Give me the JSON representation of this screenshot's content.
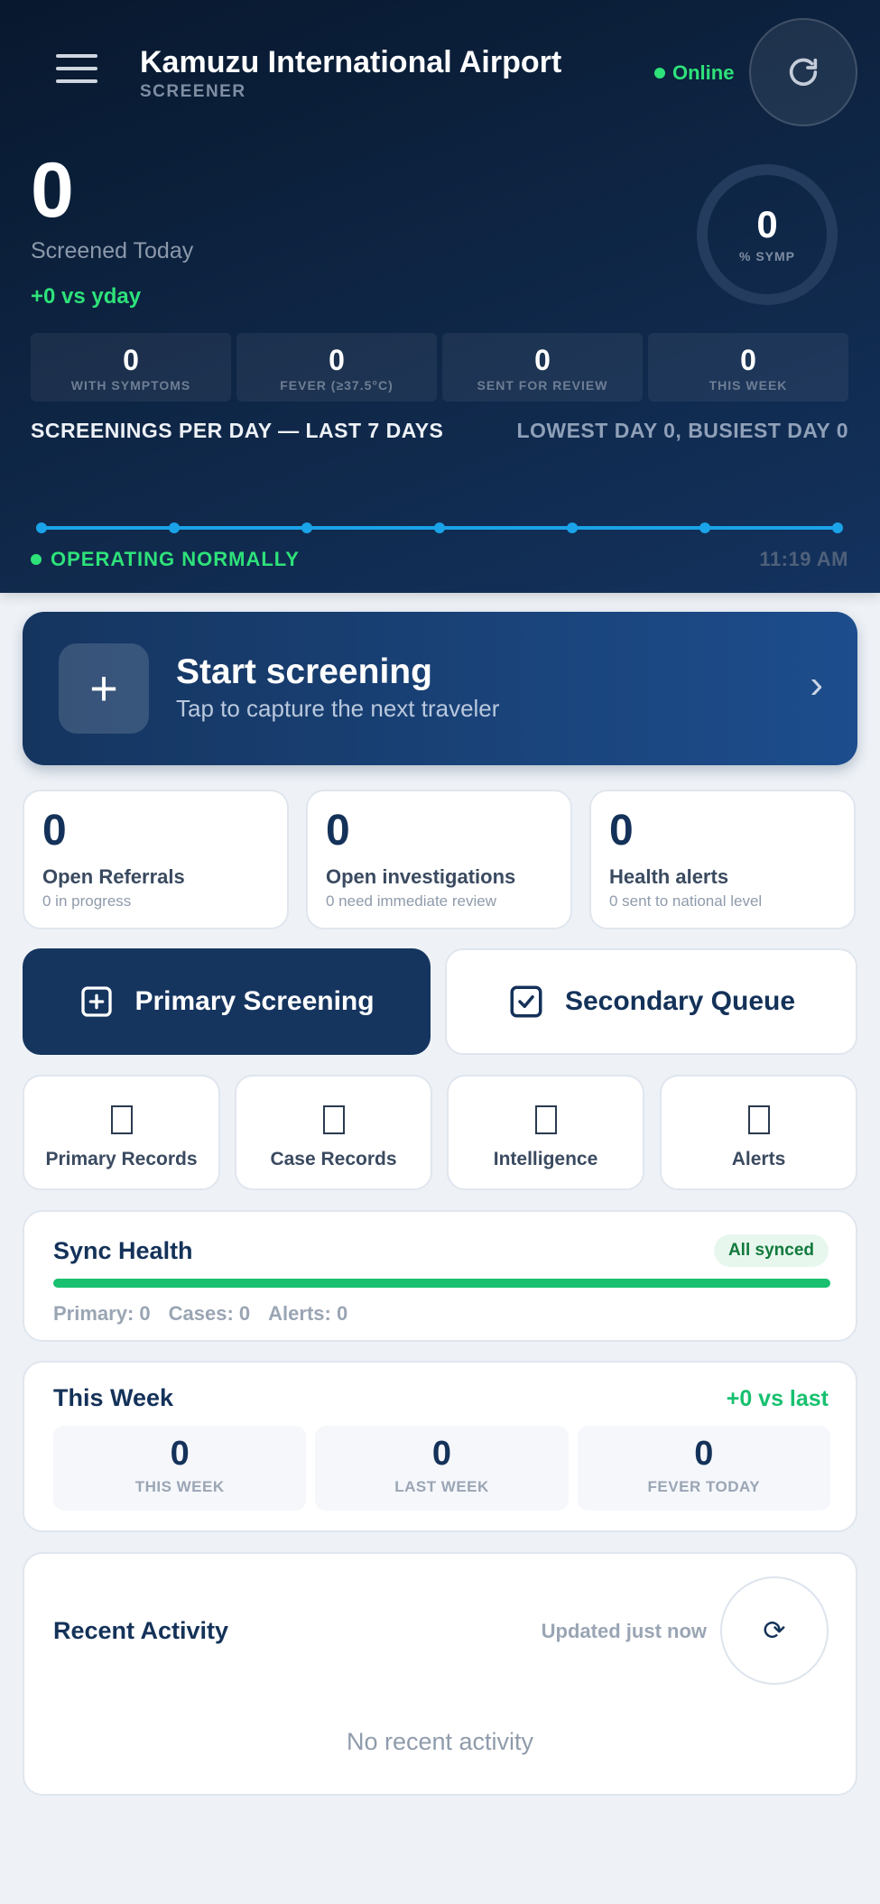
{
  "header": {
    "title": "Kamuzu International Airport",
    "role": "SCREENER",
    "status": "Online",
    "menu_icon": "hamburger-icon",
    "refresh_icon": "refresh-icon"
  },
  "summary": {
    "screened_today": "0",
    "screened_label": "Screened Today",
    "delta": "+0 vs yday",
    "symptom_pct": "0",
    "symptom_label": "% SYMP"
  },
  "kpis": [
    {
      "value": "0",
      "label": "WITH SYMPTOMS"
    },
    {
      "value": "0",
      "label": "FEVER (≥37.5°C)"
    },
    {
      "value": "0",
      "label": "SENT FOR REVIEW"
    },
    {
      "value": "0",
      "label": "THIS WEEK"
    }
  ],
  "trend": {
    "title": "SCREENINGS PER DAY — LAST 7 DAYS",
    "range": "LOWEST DAY 0, BUSIEST DAY 0"
  },
  "chart_data": {
    "type": "line",
    "x": [
      "1",
      "2",
      "3",
      "4",
      "5",
      "6",
      "7"
    ],
    "values": [
      0,
      0,
      0,
      0,
      0,
      0,
      0
    ],
    "ylim": [
      0,
      1
    ],
    "grid": false,
    "color": "#1aa3e8"
  },
  "footer_status": {
    "text": "OPERATING NORMALLY",
    "time": "11:19 AM"
  },
  "start": {
    "icon": "plus-icon",
    "title": "Start screening",
    "subtitle": "Tap to capture the next traveler",
    "chevron": "›"
  },
  "stats": [
    {
      "value": "0",
      "label": "Open Referrals",
      "sub": "0 in progress"
    },
    {
      "value": "0",
      "label": "Open investigations",
      "sub": "0 need immediate review"
    },
    {
      "value": "0",
      "label": "Health alerts",
      "sub": "0 sent to national level"
    }
  ],
  "actions": {
    "primary_label": "Primary Screening",
    "secondary_label": "Secondary Queue"
  },
  "tiles": [
    {
      "label": "Primary Records"
    },
    {
      "label": "Case Records"
    },
    {
      "label": "Intelligence"
    },
    {
      "label": "Alerts"
    }
  ],
  "sync": {
    "title": "Sync Health",
    "badge": "All synced",
    "progress": 1.0,
    "primary": "Primary: 0",
    "cases": "Cases: 0",
    "alerts": "Alerts: 0"
  },
  "week": {
    "title": "This Week",
    "delta": "+0 vs last",
    "cells": [
      {
        "value": "0",
        "label": "THIS WEEK"
      },
      {
        "value": "0",
        "label": "LAST WEEK"
      },
      {
        "value": "0",
        "label": "FEVER TODAY"
      }
    ]
  },
  "recent": {
    "title": "Recent Activity",
    "updated": "Updated just now",
    "refresh_glyph": "⟳",
    "empty": "No recent activity"
  }
}
